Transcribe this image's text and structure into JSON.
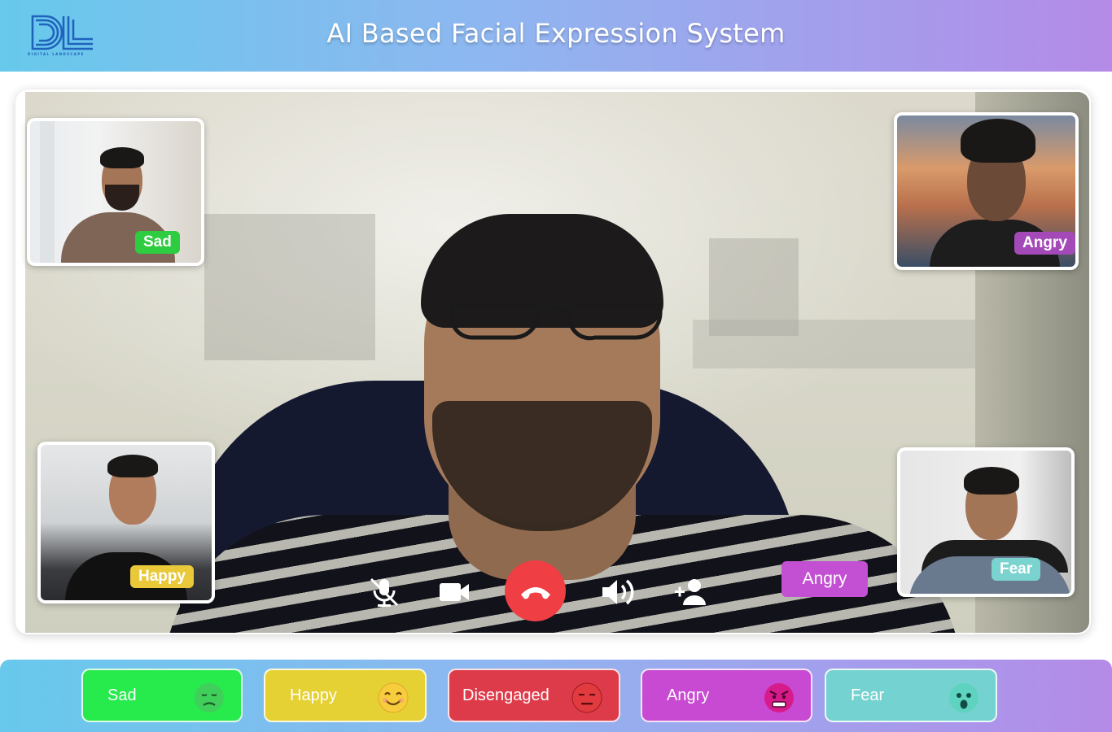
{
  "header": {
    "title": "AI Based Facial Expression System",
    "logo_subtext": "DIGITAL LANDSCAPE"
  },
  "participants": [
    {
      "position": "top-left",
      "emotion": "Sad",
      "tag_color": "#2ecc40"
    },
    {
      "position": "top-right",
      "emotion": "Angry",
      "tag_color": "#a44ab8"
    },
    {
      "position": "bottom-left",
      "emotion": "Happy",
      "tag_color": "#e9c83a"
    },
    {
      "position": "bottom-right",
      "emotion": "Fear",
      "tag_color": "#7ad3cf"
    }
  ],
  "main_speaker": {
    "emotion": "Angry",
    "tag_color": "#c34fd2"
  },
  "controls": {
    "mic_icon": "mic-muted-icon",
    "video_icon": "video-camera-icon",
    "end_call_icon": "phone-hangup-icon",
    "speaker_icon": "speaker-volume-icon",
    "add_person_icon": "add-person-icon"
  },
  "legend": [
    {
      "label": "Sad",
      "color": "#27ea4d",
      "emoji": "sad-face-icon"
    },
    {
      "label": "Happy",
      "color": "#e6d134",
      "emoji": "smiling-face-icon"
    },
    {
      "label": "Disengaged",
      "color": "#de3b4a",
      "emoji": "neutral-face-icon"
    },
    {
      "label": "Angry",
      "color": "#c849d2",
      "emoji": "angry-face-icon"
    },
    {
      "label": "Fear",
      "color": "#74d2d0",
      "emoji": "fearful-face-icon"
    }
  ]
}
